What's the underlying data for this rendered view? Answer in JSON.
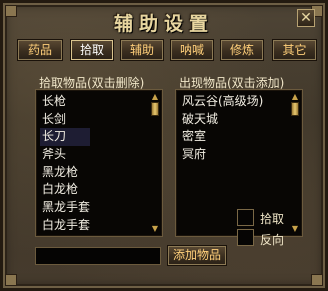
{
  "window": {
    "title": "辅助设置",
    "close_glyph": "✕"
  },
  "tabs": [
    {
      "label": "药品"
    },
    {
      "label": "拾取"
    },
    {
      "label": "辅助"
    },
    {
      "label": "呐喊"
    },
    {
      "label": "修炼"
    },
    {
      "label": "其它"
    }
  ],
  "left_panel": {
    "label": "拾取物品(双击删除)",
    "items": [
      "长枪",
      "长剑",
      "长刀",
      "斧头",
      "黑龙枪",
      "白龙枪",
      "黑龙手套",
      "白龙手套"
    ],
    "selected_index": 2
  },
  "right_panel": {
    "label": "出现物品(双击添加)",
    "items": [
      "风云谷(高级场)",
      "破天城",
      "密室",
      "冥府"
    ]
  },
  "add_item": {
    "input_value": "",
    "button_label": "添加物品"
  },
  "options": {
    "pickup_label": "拾取",
    "reverse_label": "反向",
    "pickup_checked": false,
    "reverse_checked": false
  },
  "colors": {
    "tab_text": "#ffcf7a",
    "title_text": "#e8d6a0",
    "list_bg": "#080604",
    "selected_row": "#1e1d33",
    "scroll_thumb": "#e8c870"
  },
  "icons": {
    "close": "close-icon",
    "scroll_up": "scroll-up-arrow-icon",
    "scroll_down": "scroll-down-arrow-icon"
  }
}
